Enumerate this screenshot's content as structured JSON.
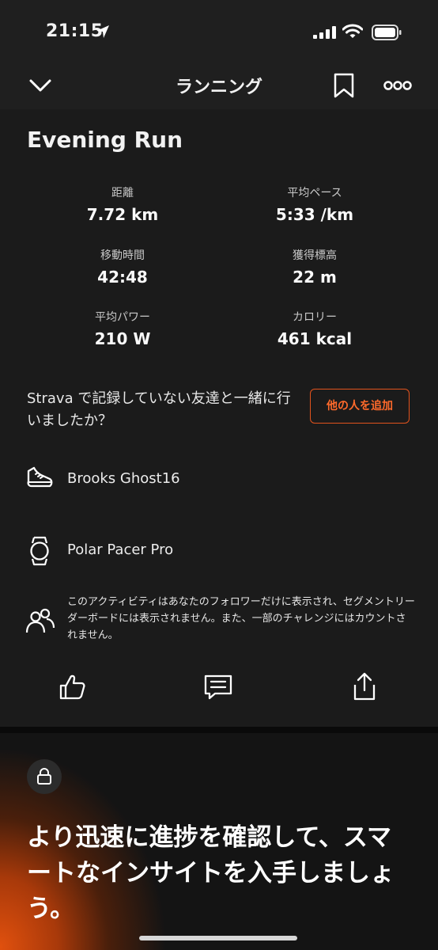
{
  "status_bar": {
    "time": "21:15"
  },
  "header": {
    "title": "ランニング"
  },
  "activity": {
    "title": "Evening Run",
    "stats": [
      {
        "label": "距離",
        "value": "7.72 km"
      },
      {
        "label": "平均ペース",
        "value": "5:33 /km"
      },
      {
        "label": "移動時間",
        "value": "42:48"
      },
      {
        "label": "獲得標高",
        "value": "22 m"
      },
      {
        "label": "平均パワー",
        "value": "210 W"
      },
      {
        "label": "カロリー",
        "value": "461 kcal"
      }
    ]
  },
  "tag_friends": {
    "prompt": "Strava で記録していない友達と一緒に行いましたか？",
    "button_label": "他の人を追加"
  },
  "gear": {
    "shoes": "Brooks Ghost16",
    "device": "Polar Pacer Pro"
  },
  "privacy": {
    "text": "このアクティビティはあなたのフォロワーだけに表示され、セグメントリーダーボードには表示されません。また、一部のチャレンジにはカウントされません。"
  },
  "actions": {
    "icons": [
      "thumbs-up-icon",
      "comment-icon",
      "share-icon"
    ]
  },
  "promo": {
    "text": "より迅速に進捗を確認して、スマートなインサイトを入手しましょう。"
  },
  "colors": {
    "accent": "#fc5200",
    "background": "#1b1b1b"
  }
}
